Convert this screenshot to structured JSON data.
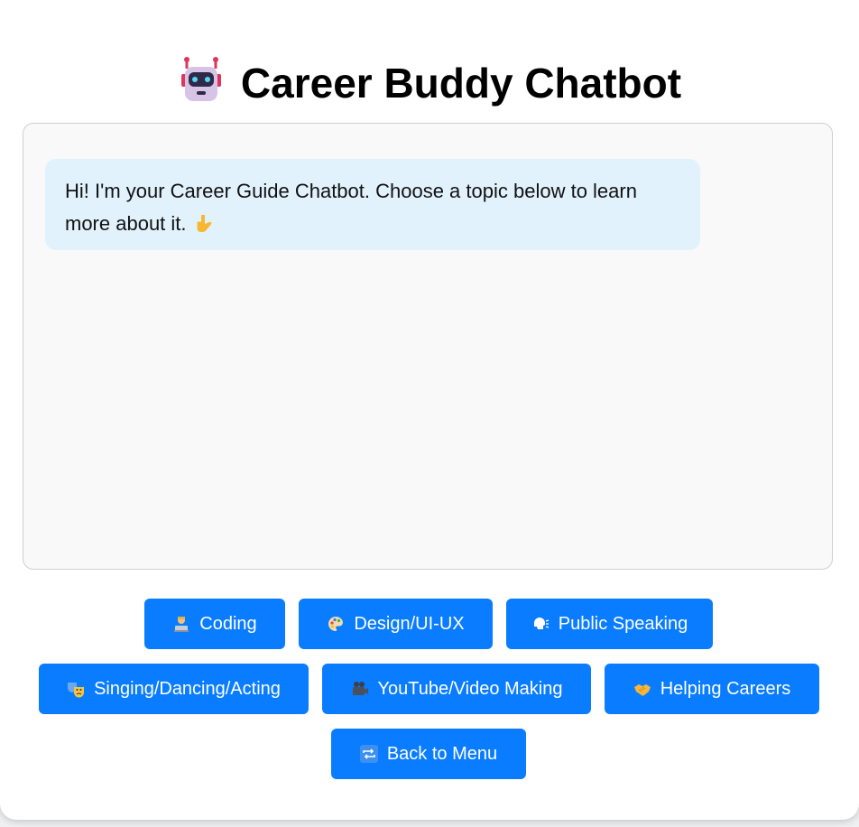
{
  "header": {
    "title": "Career Buddy Chatbot",
    "icon": "robot-icon"
  },
  "chat": {
    "messages": [
      {
        "from": "bot",
        "text": "Hi! I'm your Career Guide Chatbot. Choose a topic below to learn more about it.",
        "trailing_icon": "pointing-down-icon"
      }
    ]
  },
  "topics": {
    "buttons": [
      {
        "label": "Coding",
        "icon": "technologist-icon"
      },
      {
        "label": "Design/UI-UX",
        "icon": "palette-icon"
      },
      {
        "label": "Public Speaking",
        "icon": "speaking-head-icon"
      },
      {
        "label": "Singing/Dancing/Acting",
        "icon": "theater-masks-icon"
      },
      {
        "label": "YouTube/Video Making",
        "icon": "movie-camera-icon"
      },
      {
        "label": "Helping Careers",
        "icon": "handshake-icon"
      },
      {
        "label": "Back to Menu",
        "icon": "repeat-icon"
      }
    ]
  },
  "colors": {
    "button_bg": "#0a7cff",
    "bubble_bg": "#e1f2fc",
    "chat_bg": "#f9f9f9"
  }
}
